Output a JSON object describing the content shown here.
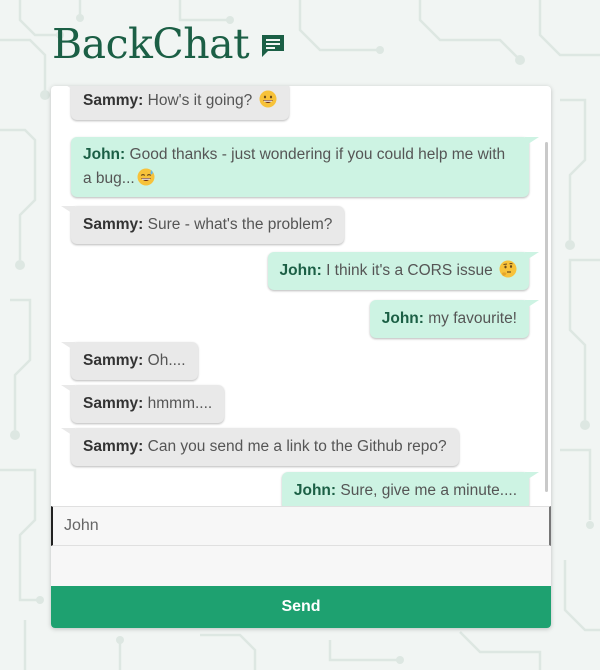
{
  "app": {
    "title": "BackChat",
    "icon": "chat-bubble-icon",
    "accent_color": "#1ea170",
    "brand_color": "#1b5f45"
  },
  "messages": [
    {
      "author": "Sammy",
      "text": "How's it going?",
      "emoji": "grinning-face",
      "side": "theirs"
    },
    {
      "author": "John",
      "text": "Good thanks - just wondering if you could help me with a bug...",
      "emoji": "sweat-smile-face",
      "side": "mine"
    },
    {
      "author": "Sammy",
      "text": "Sure - what's the problem?",
      "side": "theirs"
    },
    {
      "author": "John",
      "text": "I think it's a CORS issue",
      "emoji": "thinking-face",
      "side": "mine"
    },
    {
      "author": "John",
      "text": "my favourite!",
      "side": "mine"
    },
    {
      "author": "Sammy",
      "text": "Oh....",
      "side": "theirs"
    },
    {
      "author": "Sammy",
      "text": "hmmm....",
      "side": "theirs"
    },
    {
      "author": "Sammy",
      "text": "Can you send me a link to the Github repo?",
      "side": "theirs"
    },
    {
      "author": "John",
      "text": "Sure, give me a minute....",
      "side": "mine"
    }
  ],
  "composer": {
    "name_value": "John",
    "message_value": "",
    "send_label": "Send"
  }
}
